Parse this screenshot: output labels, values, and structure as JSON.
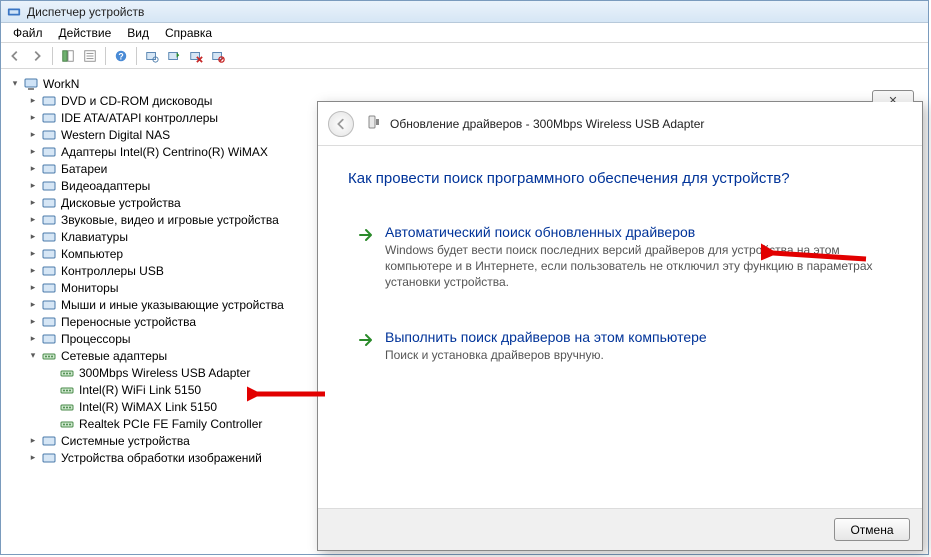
{
  "window": {
    "title": "Диспетчер устройств"
  },
  "menu": {
    "file": "Файл",
    "action": "Действие",
    "view": "Вид",
    "help": "Справка"
  },
  "tree": {
    "root": "WorkN",
    "items": [
      "DVD и CD-ROM дисководы",
      "IDE ATA/ATAPI контроллеры",
      "Western Digital NAS",
      "Адаптеры Intel(R) Centrino(R) WiMAX",
      "Батареи",
      "Видеоадаптеры",
      "Дисковые устройства",
      "Звуковые, видео и игровые устройства",
      "Клавиатуры",
      "Компьютер",
      "Контроллеры USB",
      "Мониторы",
      "Мыши и иные указывающие устройства",
      "Переносные устройства",
      "Процессоры"
    ],
    "netadapters_label": "Сетевые адаптеры",
    "netadapters": [
      "300Mbps Wireless USB Adapter",
      "Intel(R) WiFi Link 5150",
      "Intel(R) WiMAX Link 5150",
      "Realtek PCIe FE Family Controller"
    ],
    "after": [
      "Системные устройства",
      "Устройства обработки изображений"
    ]
  },
  "dialog": {
    "title": "Обновление драйверов - 300Mbps Wireless USB Adapter",
    "question": "Как провести поиск программного обеспечения для устройств?",
    "opt1_title": "Автоматический поиск обновленных драйверов",
    "opt1_desc": "Windows будет вести поиск последних версий драйверов для устройства на этом компьютере и в Интернете, если пользователь не отключил эту функцию в параметрах установки устройства.",
    "opt2_title": "Выполнить поиск драйверов на этом компьютере",
    "opt2_desc": "Поиск и установка драйверов вручную.",
    "cancel": "Отмена",
    "close_glyph": "✕"
  }
}
